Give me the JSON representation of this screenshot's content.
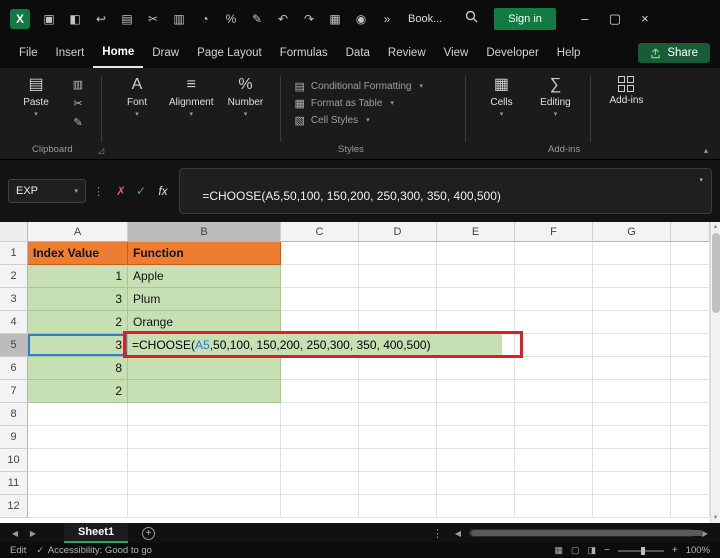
{
  "colors": {
    "excel_green": "#107C41",
    "header_orange": "#ED7D31",
    "cell_green": "#C6E0B4",
    "annotation_red": "#E01E1E",
    "reference_blue": "#1F7AE0"
  },
  "title_bar": {
    "app_initial": "X",
    "icons": [
      {
        "name": "save-icon",
        "glyph": "▣"
      },
      {
        "name": "autosave-toggle-icon",
        "glyph": "◧"
      },
      {
        "name": "back-icon",
        "glyph": "↩"
      },
      {
        "name": "clipboard-icon",
        "glyph": "▤"
      },
      {
        "name": "cut-icon",
        "glyph": "✂"
      },
      {
        "name": "paste-special-icon",
        "glyph": "▥"
      },
      {
        "name": "chart-icon",
        "glyph": "◔"
      },
      {
        "name": "percent-icon",
        "glyph": "%"
      },
      {
        "name": "draw-icon",
        "glyph": "✎"
      },
      {
        "name": "undo-icon",
        "glyph": "↶"
      },
      {
        "name": "redo-icon",
        "glyph": "↷"
      },
      {
        "name": "table-icon",
        "glyph": "▦"
      },
      {
        "name": "camera-icon",
        "glyph": "◉"
      },
      {
        "name": "more-commands-icon",
        "glyph": "»"
      }
    ],
    "document_name": "Book...",
    "sign_in": "Sign in"
  },
  "menu": {
    "items": [
      "File",
      "Insert",
      "Home",
      "Draw",
      "Page Layout",
      "Formulas",
      "Data",
      "Review",
      "View",
      "Developer",
      "Help"
    ],
    "active_index": 2,
    "share": "Share"
  },
  "ribbon": {
    "paste_label": "Paste",
    "font_label": "Font",
    "alignment_label": "Alignment",
    "number_label": "Number",
    "styles_buttons": [
      {
        "name": "conditional-formatting-button",
        "glyph": "▤",
        "label": "Conditional Formatting"
      },
      {
        "name": "format-as-table-button",
        "glyph": "▦",
        "label": "Format as Table"
      },
      {
        "name": "cell-styles-button",
        "glyph": "▧",
        "label": "Cell Styles"
      }
    ],
    "cells_label": "Cells",
    "editing_label": "Editing",
    "addins_label": "Add-ins",
    "groups": {
      "clipboard": "Clipboard",
      "styles": "Styles",
      "addins": "Add-ins"
    }
  },
  "formula_bar": {
    "name_box": "EXP",
    "fx": "fx",
    "formula": "=CHOOSE(A5,50,100, 150,200, 250,300, 350, 400,500)"
  },
  "grid": {
    "col_letters": [
      "A",
      "B",
      "C",
      "D",
      "E",
      "F",
      "G"
    ],
    "row_count": 12,
    "active_col": "B",
    "active_row": 5,
    "cells": [
      {
        "ref": "A1",
        "text": "Index Value",
        "type": "header"
      },
      {
        "ref": "B1",
        "text": "Function",
        "type": "header"
      },
      {
        "ref": "A2",
        "text": "1",
        "type": "num"
      },
      {
        "ref": "B2",
        "text": "Apple",
        "type": "text"
      },
      {
        "ref": "A3",
        "text": "3",
        "type": "num"
      },
      {
        "ref": "B3",
        "text": "Plum",
        "type": "text"
      },
      {
        "ref": "A4",
        "text": "2",
        "type": "num"
      },
      {
        "ref": "B4",
        "text": "Orange",
        "type": "text"
      },
      {
        "ref": "A5",
        "text": "3",
        "type": "num",
        "ref_highlight": true
      },
      {
        "ref": "A6",
        "text": "8",
        "type": "num"
      },
      {
        "ref": "B6",
        "text": "",
        "type": "text"
      },
      {
        "ref": "A7",
        "text": "2",
        "type": "num"
      },
      {
        "ref": "B7",
        "text": "",
        "type": "text"
      }
    ],
    "formula_cell": {
      "ref": "B5",
      "prefix": "=CHOOSE(",
      "ref_text": "A5",
      "suffix": ",50,100, 150,200, 250,300, 350, 400,500)"
    }
  },
  "sheet_bar": {
    "tab": "Sheet1"
  },
  "status_bar": {
    "mode": "Edit",
    "accessibility": "Accessibility: Good to go",
    "zoom": "100%"
  }
}
